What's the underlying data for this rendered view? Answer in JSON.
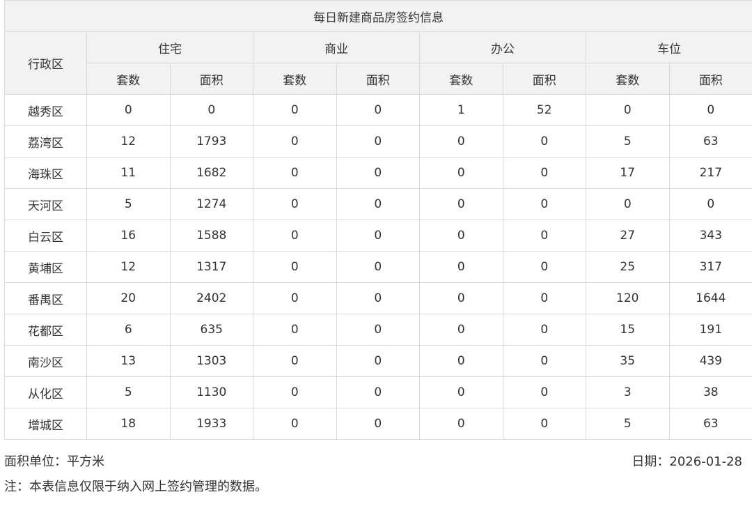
{
  "table": {
    "title": "每日新建商品房签约信息",
    "district_header": "行政区",
    "groups": [
      "住宅",
      "商业",
      "办公",
      "车位"
    ],
    "sub_headers": [
      "套数",
      "面积",
      "套数",
      "面积",
      "套数",
      "面积",
      "套数",
      "面积"
    ],
    "rows": [
      {
        "district": "越秀区",
        "values": [
          "0",
          "0",
          "0",
          "0",
          "1",
          "52",
          "0",
          "0"
        ]
      },
      {
        "district": "荔湾区",
        "values": [
          "12",
          "1793",
          "0",
          "0",
          "0",
          "0",
          "5",
          "63"
        ]
      },
      {
        "district": "海珠区",
        "values": [
          "11",
          "1682",
          "0",
          "0",
          "0",
          "0",
          "17",
          "217"
        ]
      },
      {
        "district": "天河区",
        "values": [
          "5",
          "1274",
          "0",
          "0",
          "0",
          "0",
          "0",
          "0"
        ]
      },
      {
        "district": "白云区",
        "values": [
          "16",
          "1588",
          "0",
          "0",
          "0",
          "0",
          "27",
          "343"
        ]
      },
      {
        "district": "黄埔区",
        "values": [
          "12",
          "1317",
          "0",
          "0",
          "0",
          "0",
          "25",
          "317"
        ]
      },
      {
        "district": "番禺区",
        "values": [
          "20",
          "2402",
          "0",
          "0",
          "0",
          "0",
          "120",
          "1644"
        ]
      },
      {
        "district": "花都区",
        "values": [
          "6",
          "635",
          "0",
          "0",
          "0",
          "0",
          "15",
          "191"
        ]
      },
      {
        "district": "南沙区",
        "values": [
          "13",
          "1303",
          "0",
          "0",
          "0",
          "0",
          "35",
          "439"
        ]
      },
      {
        "district": "从化区",
        "values": [
          "5",
          "1130",
          "0",
          "0",
          "0",
          "0",
          "3",
          "38"
        ]
      },
      {
        "district": "增城区",
        "values": [
          "18",
          "1933",
          "0",
          "0",
          "0",
          "0",
          "5",
          "63"
        ]
      }
    ]
  },
  "footer": {
    "unit": "面积单位：平方米",
    "date": "日期：2026-01-28",
    "note": "注：本表信息仅限于纳入网上签约管理的数据。"
  }
}
